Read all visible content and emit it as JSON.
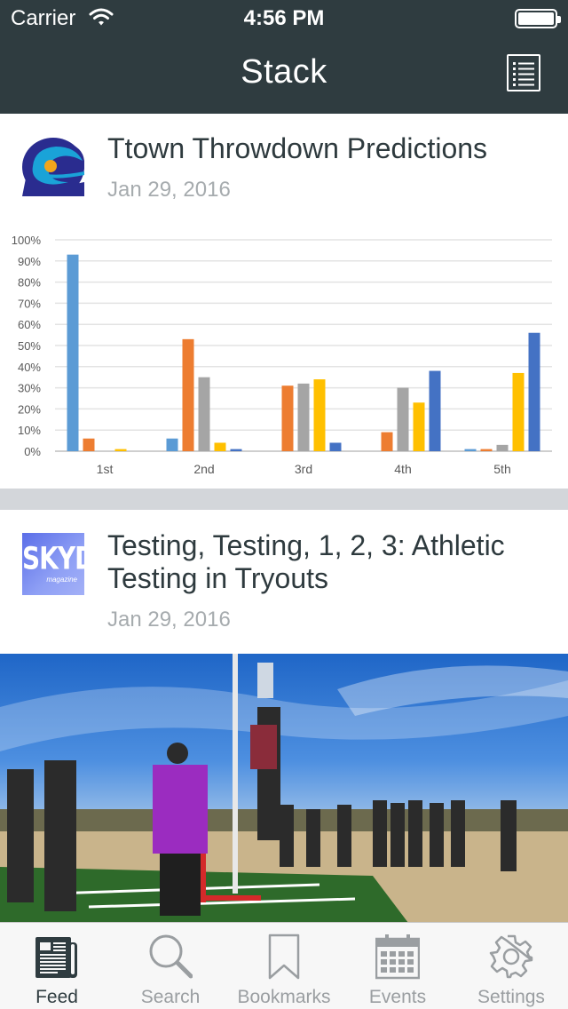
{
  "status_bar": {
    "carrier": "Carrier",
    "time": "4:56 PM"
  },
  "nav": {
    "title": "Stack"
  },
  "feed": [
    {
      "title": "Ttown Throwdown Predictions",
      "date": "Jan 29, 2016",
      "logo_icon": "ultimate-club-logo"
    },
    {
      "title": "Testing, Testing, 1, 2, 3: Athletic Testing in Tryouts",
      "date": "Jan 29, 2016",
      "logo_icon": "skyd-magazine-logo",
      "logo_text": "SKYD",
      "logo_subtext": "magazine"
    }
  ],
  "chart_data": {
    "type": "bar",
    "categories": [
      "1st",
      "2nd",
      "3rd",
      "4th",
      "5th"
    ],
    "y_ticks": [
      "0%",
      "10%",
      "20%",
      "30%",
      "40%",
      "50%",
      "60%",
      "70%",
      "80%",
      "90%",
      "100%"
    ],
    "ylim": [
      0,
      100
    ],
    "grid": true,
    "colors": [
      "#5b9bd5",
      "#ed7d31",
      "#a5a5a5",
      "#ffc000",
      "#4472c4"
    ],
    "series": [
      {
        "values": [
          93,
          6,
          0,
          0,
          1
        ]
      },
      {
        "values": [
          6,
          53,
          31,
          9,
          1
        ]
      },
      {
        "values": [
          0,
          35,
          32,
          30,
          3
        ]
      },
      {
        "values": [
          1,
          4,
          34,
          23,
          37
        ]
      },
      {
        "values": [
          0,
          1,
          4,
          38,
          56
        ]
      }
    ]
  },
  "tabs": [
    {
      "label": "Feed",
      "icon": "feed-icon",
      "active": true
    },
    {
      "label": "Search",
      "icon": "search-icon",
      "active": false
    },
    {
      "label": "Bookmarks",
      "icon": "bookmark-icon",
      "active": false
    },
    {
      "label": "Events",
      "icon": "calendar-icon",
      "active": false
    },
    {
      "label": "Settings",
      "icon": "gear-icon",
      "active": false
    }
  ],
  "colors": {
    "nav_bg": "#2f3c40",
    "separator": "#d3d6da",
    "tab_active": "#2f3c40",
    "tab_inactive": "#9a9ea1"
  }
}
